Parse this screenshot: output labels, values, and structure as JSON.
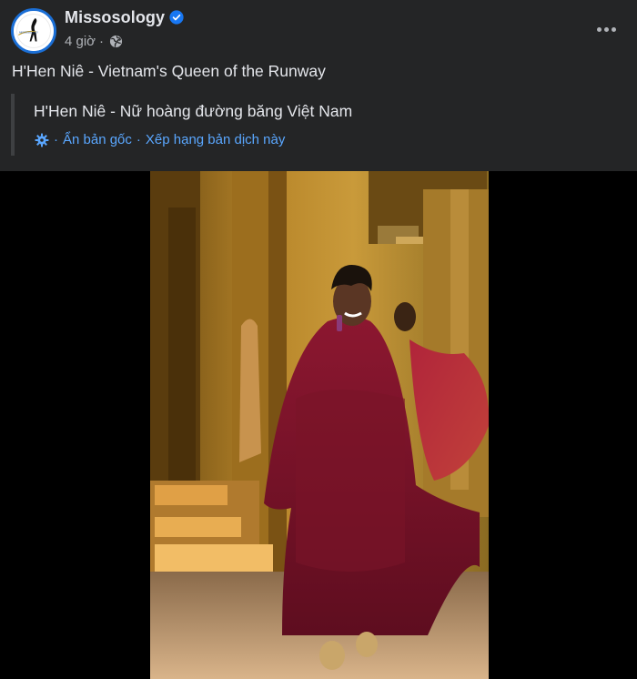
{
  "post": {
    "page_name": "Missosology",
    "time": "4 giờ",
    "dot": "·",
    "caption": "H'Hen Niê - Vietnam's Queen of the Runway"
  },
  "translation": {
    "text": "H'Hen Niê - Nữ hoàng đường băng Việt Nam",
    "hide_original": "Ẩn bản gốc",
    "separator": "·",
    "rate": "Xếp hạng bản dịch này"
  },
  "icons": {
    "verified": "verified-badge-icon",
    "privacy": "globe-icon",
    "more": "more-options-icon",
    "translation": "gear-icon"
  },
  "colors": {
    "background": "#242526",
    "link": "#5aa7ff",
    "verified": "#1877f2",
    "secondary_text": "#b0b3b8"
  }
}
